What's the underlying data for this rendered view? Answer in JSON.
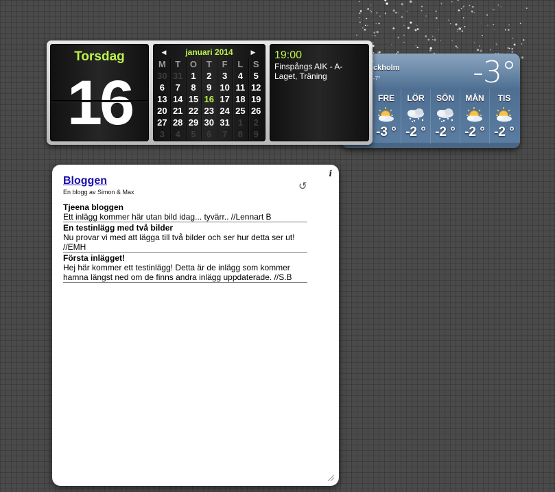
{
  "weather": {
    "city": "ckholm",
    "dash": "-",
    "low": "-7°",
    "current_temp": "-3°",
    "forecast": [
      {
        "day": "FRE",
        "temp": "-3 °",
        "icon": "sun-cloud-icon"
      },
      {
        "day": "LÖR",
        "temp": "-2 °",
        "icon": "snow-cloud-icon"
      },
      {
        "day": "SÖN",
        "temp": "-2 °",
        "icon": "snow-cloud-icon"
      },
      {
        "day": "MÅN",
        "temp": "-2 °",
        "icon": "sun-cloud-icon"
      },
      {
        "day": "TIS",
        "temp": "-2 °",
        "icon": "sun-cloud-icon"
      }
    ]
  },
  "calendar": {
    "weekday": "Torsdag",
    "day_number": "16",
    "month_title": "januari 2014",
    "headers": [
      "M",
      "T",
      "O",
      "T",
      "F",
      "L",
      "S"
    ],
    "weeks": [
      [
        {
          "d": "30",
          "s": "dim"
        },
        {
          "d": "31",
          "s": "dim"
        },
        {
          "d": "1"
        },
        {
          "d": "2"
        },
        {
          "d": "3"
        },
        {
          "d": "4"
        },
        {
          "d": "5"
        }
      ],
      [
        {
          "d": "6"
        },
        {
          "d": "7"
        },
        {
          "d": "8"
        },
        {
          "d": "9"
        },
        {
          "d": "10"
        },
        {
          "d": "11"
        },
        {
          "d": "12"
        }
      ],
      [
        {
          "d": "13"
        },
        {
          "d": "14"
        },
        {
          "d": "15"
        },
        {
          "d": "16",
          "s": "today"
        },
        {
          "d": "17"
        },
        {
          "d": "18"
        },
        {
          "d": "19"
        }
      ],
      [
        {
          "d": "20"
        },
        {
          "d": "21"
        },
        {
          "d": "22"
        },
        {
          "d": "23"
        },
        {
          "d": "24"
        },
        {
          "d": "25"
        },
        {
          "d": "26"
        }
      ],
      [
        {
          "d": "27"
        },
        {
          "d": "28"
        },
        {
          "d": "29"
        },
        {
          "d": "30"
        },
        {
          "d": "31"
        },
        {
          "d": "1",
          "s": "dim"
        },
        {
          "d": "2",
          "s": "dim"
        }
      ],
      [
        {
          "d": "3",
          "s": "dim"
        },
        {
          "d": "4",
          "s": "dim"
        },
        {
          "d": "5",
          "s": "dim"
        },
        {
          "d": "6",
          "s": "dim"
        },
        {
          "d": "7",
          "s": "dim"
        },
        {
          "d": "8",
          "s": "dim"
        },
        {
          "d": "9",
          "s": "dim"
        }
      ]
    ],
    "event_time": "19:00",
    "event_title": "Finspångs AIK - A-Laget, Träning",
    "accent_color": "#bdf24a"
  },
  "blog": {
    "title": "Bloggen",
    "subtitle": "En blogg av Simon & Max",
    "posts": [
      {
        "title": "Tjeena bloggen",
        "body": "Ett inlägg kommer här utan bild idag... tyvärr.. //Lennart B"
      },
      {
        "title": "En testinlägg med två bilder",
        "body": "Nu provar vi med att lägga till två bilder och ser hur detta ser ut! //EMH"
      },
      {
        "title": "Första inlägget!",
        "body": "Hej här kommer ett testinlägg! Detta är de inlägg som kommer hamna längst ned om de finns andra inlägg uppdaterade. //S.B"
      }
    ],
    "link_color": "#1a0dab"
  }
}
